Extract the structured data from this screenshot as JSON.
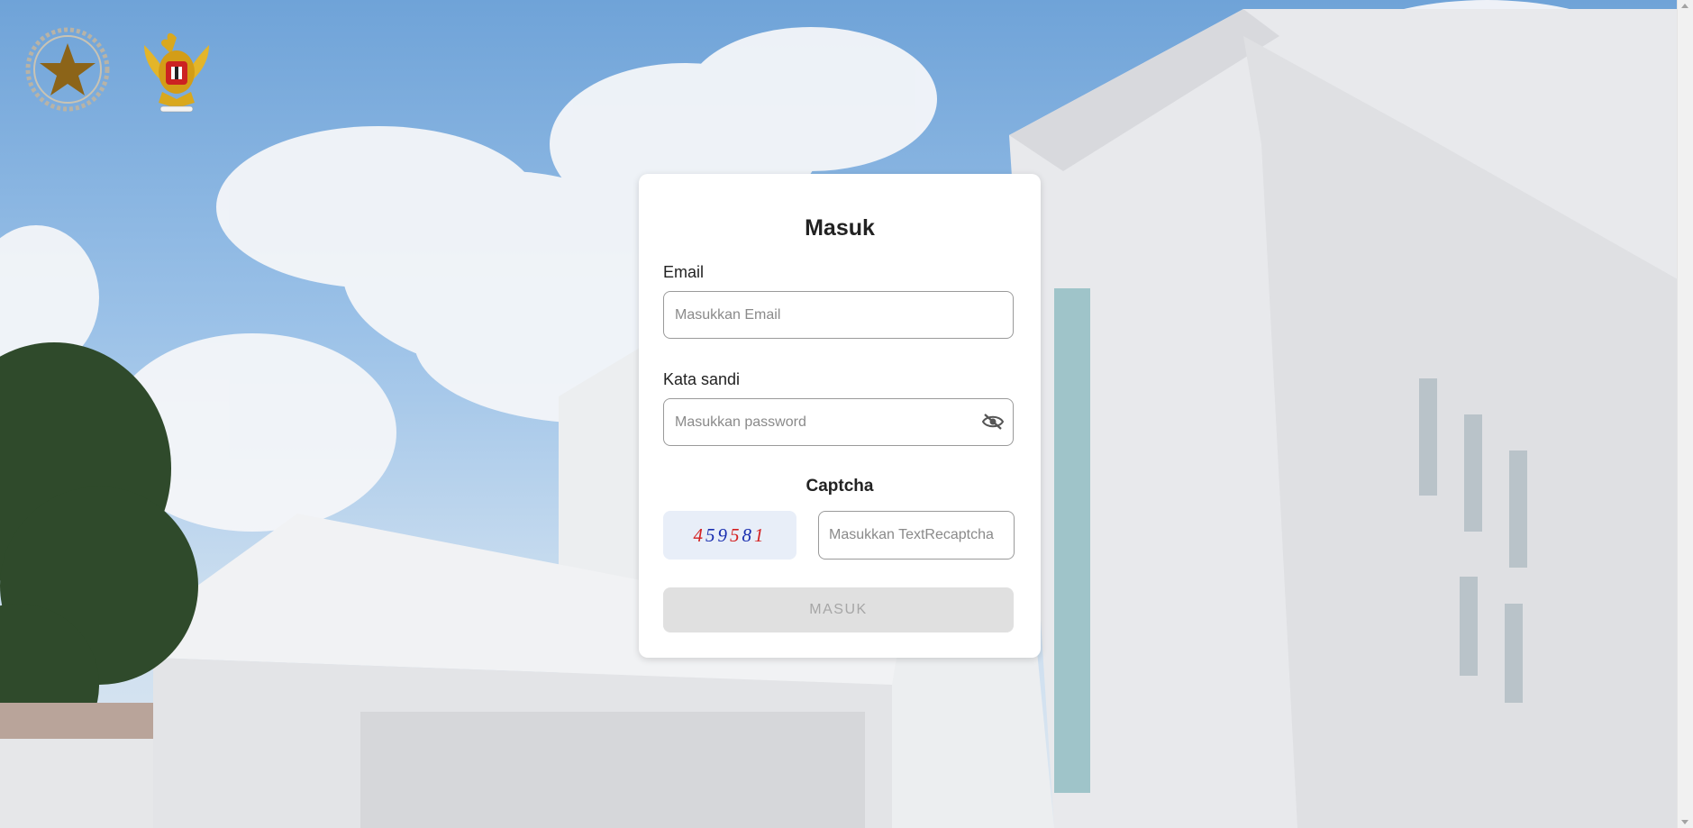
{
  "login": {
    "title": "Masuk",
    "email_label": "Email",
    "email_placeholder": "Masukkan Email",
    "email_value": "",
    "password_label": "Kata sandi",
    "password_placeholder": "Masukkan password",
    "password_value": "",
    "password_toggle_icon": "eye-slash-icon",
    "captcha_label": "Captcha",
    "captcha_digits": [
      {
        "char": "4",
        "color": "#d42020"
      },
      {
        "char": "5",
        "color": "#1a2fb0"
      },
      {
        "char": "9",
        "color": "#1a2fb0"
      },
      {
        "char": "5",
        "color": "#d42020"
      },
      {
        "char": "8",
        "color": "#1a2fb0"
      },
      {
        "char": "1",
        "color": "#d42020"
      }
    ],
    "captcha_placeholder": "Masukkan TextRecaptcha",
    "captcha_value": "",
    "submit_label": "MASUK"
  },
  "logos": [
    "star-emblem-logo",
    "garuda-pancasila-logo"
  ]
}
